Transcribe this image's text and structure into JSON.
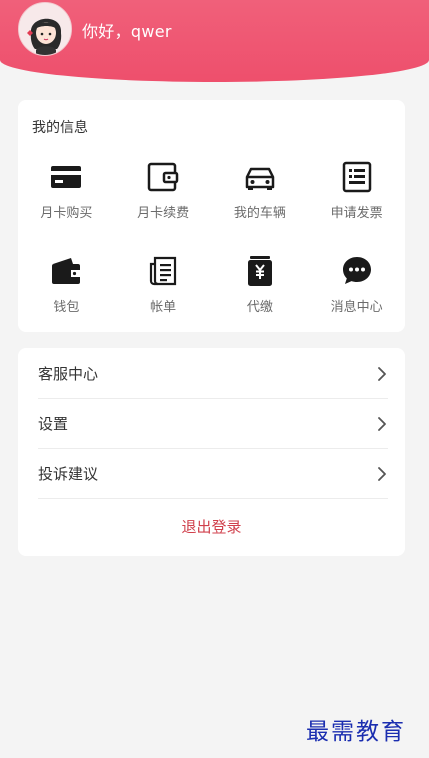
{
  "header": {
    "greeting": "你好，qwer"
  },
  "info_card": {
    "title": "我的信息",
    "items": [
      {
        "label": "月卡购买",
        "icon": "card-icon"
      },
      {
        "label": "月卡续费",
        "icon": "wallet-card-icon"
      },
      {
        "label": "我的车辆",
        "icon": "car-icon"
      },
      {
        "label": "申请发票",
        "icon": "invoice-icon"
      },
      {
        "label": "钱包",
        "icon": "wallet-icon"
      },
      {
        "label": "帐单",
        "icon": "bill-icon"
      },
      {
        "label": "代缴",
        "icon": "yuan-payment-icon"
      },
      {
        "label": "消息中心",
        "icon": "chat-bubble-icon"
      }
    ]
  },
  "menu": {
    "items": [
      {
        "label": "客服中心"
      },
      {
        "label": "设置"
      },
      {
        "label": "投诉建议"
      }
    ],
    "logout": "退出登录"
  },
  "watermark": "最需教育",
  "colors": {
    "accent": "#ee4f6c",
    "logout": "#d0404c"
  }
}
